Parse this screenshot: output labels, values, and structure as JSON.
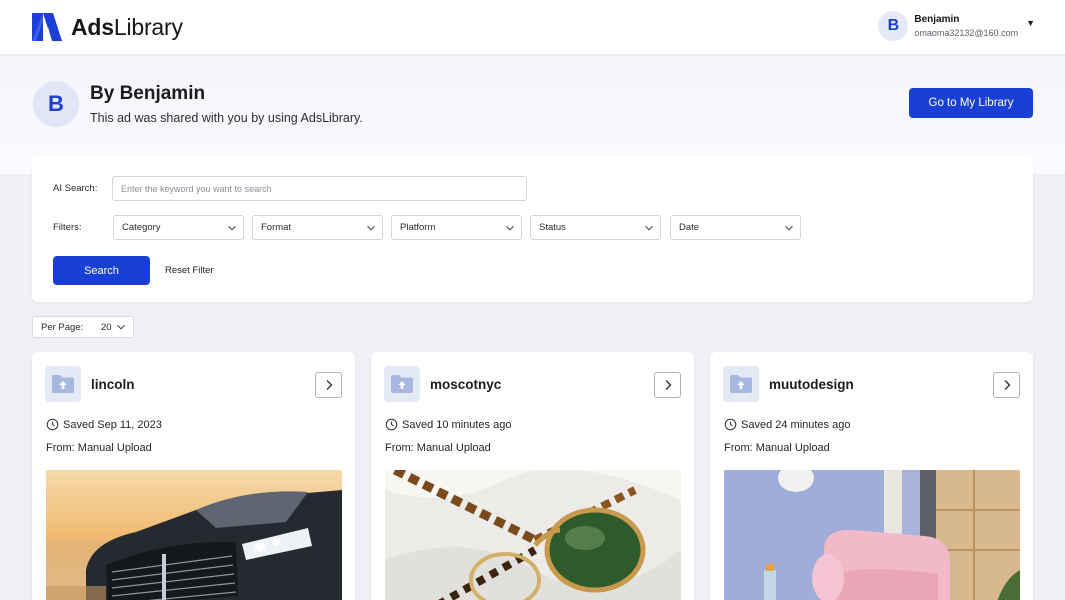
{
  "header": {
    "logo_bold": "Ads",
    "logo_light": "Library",
    "user": {
      "initial": "B",
      "name": "Benjamin",
      "email": "omaoma32132@160.com"
    }
  },
  "hero": {
    "avatar_initial": "B",
    "title": "By Benjamin",
    "subtitle": "This ad was shared with you by using AdsLibrary.",
    "goto_button": "Go to My Library"
  },
  "filters": {
    "ai_search_label": "AI Search:",
    "ai_search_placeholder": "Enter the keyword you want to search",
    "ai_search_value": "",
    "filters_label": "Filters:",
    "dropdowns": [
      "Category",
      "Format",
      "Platform",
      "Status",
      "Date"
    ],
    "search_button": "Search",
    "reset_label": "Reset Filter"
  },
  "pagination": {
    "per_page_label": "Per Page:",
    "per_page_value": "20"
  },
  "cards": [
    {
      "name": "lincoln",
      "saved": "Saved Sep 11, 2023",
      "from": "From: Manual Upload",
      "image": "car-ad"
    },
    {
      "name": "moscotnyc",
      "saved": "Saved 10 minutes ago",
      "from": "From: Manual Upload",
      "image": "sunglasses-ad"
    },
    {
      "name": "muutodesign",
      "saved": "Saved 24 minutes ago",
      "from": "From: Manual Upload",
      "image": "armchair-ad"
    }
  ],
  "colors": {
    "accent": "#1a3fd4",
    "page_bg": "#eef0f6",
    "avatar_bg": "#e1e5f6"
  }
}
